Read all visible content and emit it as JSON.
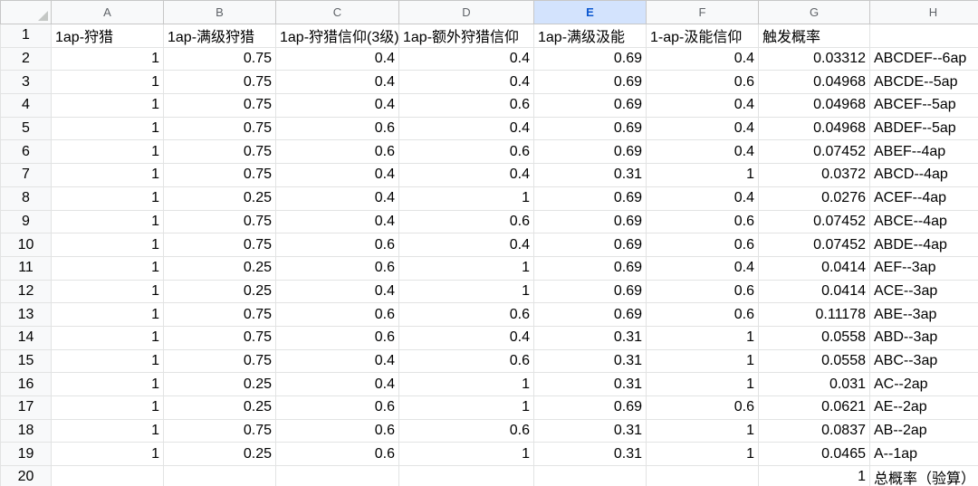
{
  "columns": [
    "A",
    "B",
    "C",
    "D",
    "E",
    "F",
    "G",
    "H"
  ],
  "selected_column": "E",
  "rows": [
    {
      "n": "1",
      "cells": [
        "1ap-狩猎",
        "1ap-满级狩猎",
        "1ap-狩猎信仰(3级)",
        "1ap-额外狩猎信仰",
        "1ap-满级汲能",
        "1-ap-汲能信仰",
        "触发概率",
        ""
      ]
    },
    {
      "n": "2",
      "cells": [
        "1",
        "0.75",
        "0.4",
        "0.4",
        "0.69",
        "0.4",
        "0.03312",
        "ABCDEF--6ap"
      ]
    },
    {
      "n": "3",
      "cells": [
        "1",
        "0.75",
        "0.4",
        "0.4",
        "0.69",
        "0.6",
        "0.04968",
        "ABCDE--5ap"
      ]
    },
    {
      "n": "4",
      "cells": [
        "1",
        "0.75",
        "0.4",
        "0.6",
        "0.69",
        "0.4",
        "0.04968",
        "ABCEF--5ap"
      ]
    },
    {
      "n": "5",
      "cells": [
        "1",
        "0.75",
        "0.6",
        "0.4",
        "0.69",
        "0.4",
        "0.04968",
        "ABDEF--5ap"
      ]
    },
    {
      "n": "6",
      "cells": [
        "1",
        "0.75",
        "0.6",
        "0.6",
        "0.69",
        "0.4",
        "0.07452",
        "ABEF--4ap"
      ]
    },
    {
      "n": "7",
      "cells": [
        "1",
        "0.75",
        "0.4",
        "0.4",
        "0.31",
        "1",
        "0.0372",
        "ABCD--4ap"
      ]
    },
    {
      "n": "8",
      "cells": [
        "1",
        "0.25",
        "0.4",
        "1",
        "0.69",
        "0.4",
        "0.0276",
        "ACEF--4ap"
      ]
    },
    {
      "n": "9",
      "cells": [
        "1",
        "0.75",
        "0.4",
        "0.6",
        "0.69",
        "0.6",
        "0.07452",
        "ABCE--4ap"
      ]
    },
    {
      "n": "10",
      "cells": [
        "1",
        "0.75",
        "0.6",
        "0.4",
        "0.69",
        "0.6",
        "0.07452",
        "ABDE--4ap"
      ]
    },
    {
      "n": "11",
      "cells": [
        "1",
        "0.25",
        "0.6",
        "1",
        "0.69",
        "0.4",
        "0.0414",
        "AEF--3ap"
      ]
    },
    {
      "n": "12",
      "cells": [
        "1",
        "0.25",
        "0.4",
        "1",
        "0.69",
        "0.6",
        "0.0414",
        "ACE--3ap"
      ]
    },
    {
      "n": "13",
      "cells": [
        "1",
        "0.75",
        "0.6",
        "0.6",
        "0.69",
        "0.6",
        "0.11178",
        "ABE--3ap"
      ]
    },
    {
      "n": "14",
      "cells": [
        "1",
        "0.75",
        "0.6",
        "0.4",
        "0.31",
        "1",
        "0.0558",
        "ABD--3ap"
      ]
    },
    {
      "n": "15",
      "cells": [
        "1",
        "0.75",
        "0.4",
        "0.6",
        "0.31",
        "1",
        "0.0558",
        "ABC--3ap"
      ]
    },
    {
      "n": "16",
      "cells": [
        "1",
        "0.25",
        "0.4",
        "1",
        "0.31",
        "1",
        "0.031",
        "AC--2ap"
      ]
    },
    {
      "n": "17",
      "cells": [
        "1",
        "0.25",
        "0.6",
        "1",
        "0.69",
        "0.6",
        "0.0621",
        "AE--2ap"
      ]
    },
    {
      "n": "18",
      "cells": [
        "1",
        "0.75",
        "0.6",
        "0.6",
        "0.31",
        "1",
        "0.0837",
        "AB--2ap"
      ]
    },
    {
      "n": "19",
      "cells": [
        "1",
        "0.25",
        "0.6",
        "1",
        "0.31",
        "1",
        "0.0465",
        "A--1ap"
      ]
    },
    {
      "n": "20",
      "cells": [
        "",
        "",
        "",
        "",
        "",
        "",
        "1",
        "总概率（验算）"
      ]
    }
  ],
  "colors": {
    "header_bg": "#f8f9fa",
    "selected_header_bg": "#d3e3fd",
    "selected_header_text": "#0b57d0",
    "gridline": "#e2e3e3"
  }
}
